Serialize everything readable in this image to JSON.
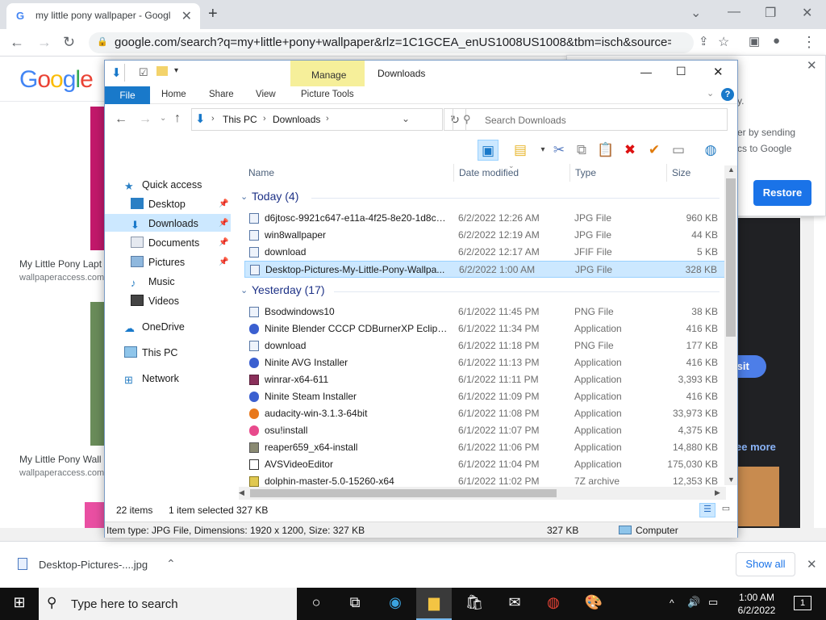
{
  "browser": {
    "tab_title": "my little pony wallpaper - Googl",
    "url": "google.com/search?q=my+little+pony+wallpaper&rlz=1C1GCEA_enUS1008US1008&tbm=isch&source=iu&ictx..."
  },
  "google": {
    "logo": "Google",
    "results": [
      {
        "caption": "My Little Pony Lapt",
        "source": "wallpaperaccess.com"
      },
      {
        "caption": "My Little Pony Wall",
        "source": "wallpaperaccess.com"
      }
    ],
    "popup_text1": "er by sending",
    "popup_text2": "cs to Google",
    "popup_text0": "y.",
    "restore_label": "Restore",
    "visit_label": "isit",
    "see_more_label": "ee more"
  },
  "download_bar": {
    "file": "Desktop-Pictures-....jpg",
    "show_all": "Show all"
  },
  "taskbar": {
    "search_placeholder": "Type here to search",
    "time": "1:00 AM",
    "date": "6/2/2022",
    "notifications": "1"
  },
  "explorer": {
    "manage": "Manage",
    "title": "Downloads",
    "ribbon_tabs": [
      "File",
      "Home",
      "Share",
      "View",
      "Picture Tools"
    ],
    "breadcrumb": [
      "This PC",
      "Downloads"
    ],
    "search_placeholder": "Search Downloads",
    "nav": [
      {
        "label": "Quick access"
      },
      {
        "label": "Desktop"
      },
      {
        "label": "Downloads"
      },
      {
        "label": "Documents"
      },
      {
        "label": "Pictures"
      },
      {
        "label": "Music"
      },
      {
        "label": "Videos"
      },
      {
        "label": "OneDrive"
      },
      {
        "label": "This PC"
      },
      {
        "label": "Network"
      }
    ],
    "columns": [
      "Name",
      "Date modified",
      "Type",
      "Size"
    ],
    "groups": [
      {
        "label": "Today (4)",
        "files": [
          {
            "name": "d6jtosc-9921c647-e11a-4f25-8e20-1d8c0...",
            "date": "6/2/2022 12:26 AM",
            "type": "JPG File",
            "size": "960 KB"
          },
          {
            "name": "win8wallpaper",
            "date": "6/2/2022 12:19 AM",
            "type": "JPG File",
            "size": "44 KB"
          },
          {
            "name": "download",
            "date": "6/2/2022 12:17 AM",
            "type": "JFIF File",
            "size": "5 KB"
          },
          {
            "name": "Desktop-Pictures-My-Little-Pony-Wallpa...",
            "date": "6/2/2022 1:00 AM",
            "type": "JPG File",
            "size": "328 KB"
          }
        ]
      },
      {
        "label": "Yesterday (17)",
        "files": [
          {
            "name": "Bsodwindows10",
            "date": "6/1/2022 11:45 PM",
            "type": "PNG File",
            "size": "38 KB"
          },
          {
            "name": "Ninite Blender CCCP CDBurnerXP Eclipse...",
            "date": "6/1/2022 11:34 PM",
            "type": "Application",
            "size": "416 KB"
          },
          {
            "name": "download",
            "date": "6/1/2022 11:18 PM",
            "type": "PNG File",
            "size": "177 KB"
          },
          {
            "name": "Ninite AVG Installer",
            "date": "6/1/2022 11:13 PM",
            "type": "Application",
            "size": "416 KB"
          },
          {
            "name": "winrar-x64-611",
            "date": "6/1/2022 11:11 PM",
            "type": "Application",
            "size": "3,393 KB"
          },
          {
            "name": "Ninite Steam Installer",
            "date": "6/1/2022 11:09 PM",
            "type": "Application",
            "size": "416 KB"
          },
          {
            "name": "audacity-win-3.1.3-64bit",
            "date": "6/1/2022 11:08 PM",
            "type": "Application",
            "size": "33,973 KB"
          },
          {
            "name": "osu!install",
            "date": "6/1/2022 11:07 PM",
            "type": "Application",
            "size": "4,375 KB"
          },
          {
            "name": "reaper659_x64-install",
            "date": "6/1/2022 11:06 PM",
            "type": "Application",
            "size": "14,880 KB"
          },
          {
            "name": "AVSVideoEditor",
            "date": "6/1/2022 11:04 PM",
            "type": "Application",
            "size": "175,030 KB"
          },
          {
            "name": "dolphin-master-5.0-15260-x64",
            "date": "6/1/2022 11:02 PM",
            "type": "7Z archive",
            "size": "12,353 KB"
          }
        ]
      }
    ],
    "status": {
      "items": "22 items",
      "selected": "1 item selected",
      "size": "327 KB"
    },
    "details": {
      "info": "Item type: JPG File, Dimensions: 1920 x 1200, Size: 327 KB",
      "size": "327 KB",
      "location": "Computer"
    }
  }
}
